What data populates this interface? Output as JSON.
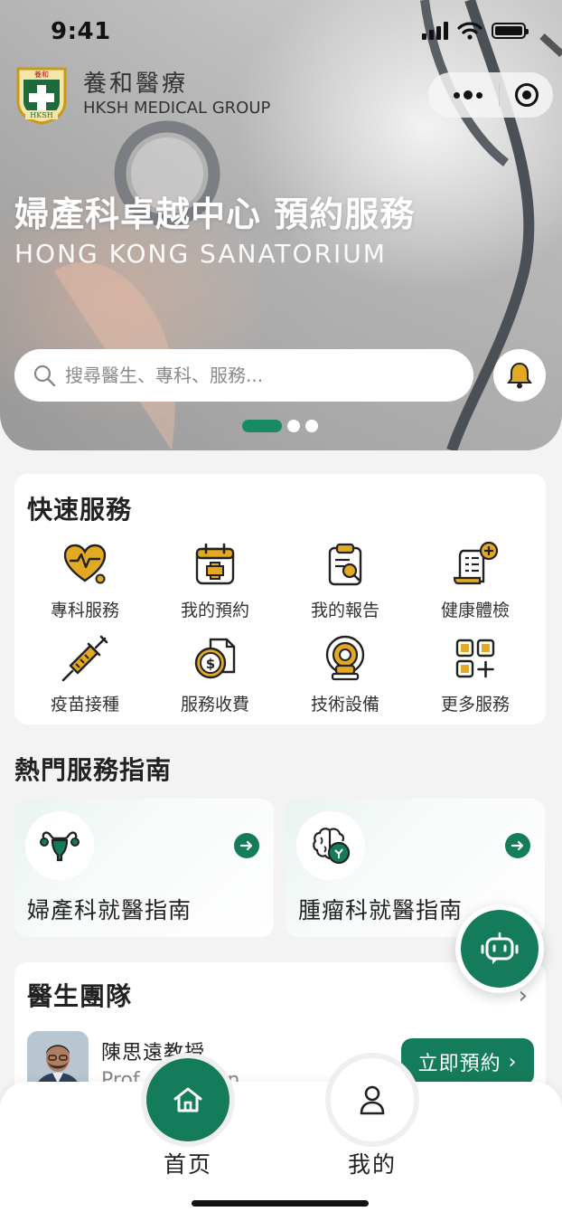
{
  "status_bar": {
    "time": "9:41"
  },
  "brand": {
    "name_zh": "養和醫療",
    "name_en": "HKSH MEDICAL GROUP",
    "logo_text_top": "養和",
    "logo_text_bottom": "HKSH"
  },
  "hero": {
    "title": "婦產科卓越中心 預約服務",
    "subtitle": "HONG  KONG  SANATORIUM",
    "slides_total": 3,
    "active_slide": 1
  },
  "search": {
    "placeholder": "搜尋醫生、專科、服務..."
  },
  "quick_services": {
    "title": "快速服務",
    "items": [
      {
        "label": "專科服務",
        "icon": "heart-pulse-icon"
      },
      {
        "label": "我的預約",
        "icon": "calendar-plus-icon"
      },
      {
        "label": "我的報告",
        "icon": "clipboard-search-icon"
      },
      {
        "label": "健康體檢",
        "icon": "checklist-plus-icon"
      },
      {
        "label": "疫苗接種",
        "icon": "syringe-icon"
      },
      {
        "label": "服務收費",
        "icon": "coin-document-icon"
      },
      {
        "label": "技術設備",
        "icon": "scanner-machine-icon"
      },
      {
        "label": "更多服務",
        "icon": "grid-plus-icon"
      }
    ]
  },
  "hot_guides": {
    "title": "熱門服務指南",
    "items": [
      {
        "label": "婦產科就醫指南",
        "icon": "uterus-icon"
      },
      {
        "label": "腫瘤科就醫指南",
        "icon": "brain-icon"
      }
    ]
  },
  "doctors": {
    "title": "醫生團隊",
    "list": [
      {
        "name": "陳思遠教授",
        "name_en": "Prof.  Sze Yuen",
        "book_label": "立即預約",
        "extra": "醫生"
      }
    ]
  },
  "tabbar": {
    "home_label": "首页",
    "me_label": "我的"
  },
  "colors": {
    "brand_green": "#157c5b",
    "accent_gold": "#d9a21b"
  }
}
